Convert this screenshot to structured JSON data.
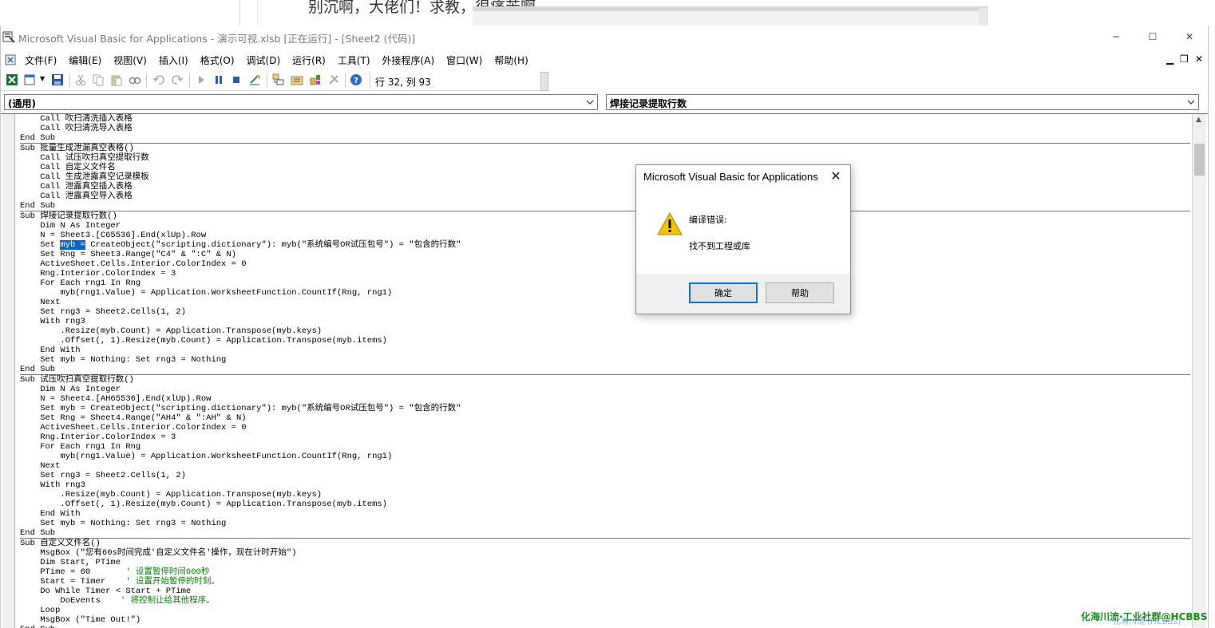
{
  "forum": {
    "text": "别沉啊，大佬们！求教，很痛苦啊 。。。"
  },
  "window": {
    "title": "Microsoft Visual Basic for Applications - 演示可视.xlsb [正在运行] - [Sheet2 (代码)]",
    "minimize": "─",
    "maximize": "☐",
    "close": "✕"
  },
  "menu": {
    "items": [
      "文件(F)",
      "编辑(E)",
      "视图(V)",
      "插入(I)",
      "格式(O)",
      "调试(D)",
      "运行(R)",
      "工具(T)",
      "外接程序(A)",
      "窗口(W)",
      "帮助(H)"
    ],
    "mdi_min": "▁",
    "mdi_restore": "❐",
    "mdi_close": "✕"
  },
  "toolbar": {
    "status": "行 32, 列 93",
    "icons": [
      "excel-icon",
      "insert-module-icon",
      "save-icon",
      "cut-icon",
      "copy-icon",
      "paste-icon",
      "find-icon",
      "undo-icon",
      "redo-icon",
      "run-icon",
      "break-icon",
      "reset-icon",
      "design-mode-icon",
      "project-explorer-icon",
      "properties-icon",
      "object-browser-icon",
      "toolbox-icon",
      "help-icon"
    ]
  },
  "combos": {
    "object": "(通用)",
    "procedure": "焊接记录提取行数"
  },
  "code": {
    "blocks": [
      [
        "    Call 吹扫清洗插入表格",
        "    Call 吹扫清洗导入表格",
        "End Sub"
      ],
      [
        "Sub 批量生成泄漏真空表格()",
        "    Call 试压吹扫真空提取行数",
        "    Call 自定义文件名",
        "    Call 生成泄露真空记录模板",
        "    Call 泄露真空插入表格",
        "    Call 泄露真空导入表格",
        "End Sub"
      ],
      [
        "Sub 焊接记录提取行数()",
        "    Dim N As Integer",
        "    N = Sheet3.[C65536].End(xlUp).Row",
        "    Set myb = CreateObject(\"scripting.dictionary\"): myb(\"系统编号OR试压包号\") = \"包含的行数\"",
        "    Set Rng = Sheet3.Range(\"C4\" & \":C\" & N)",
        "    ActiveSheet.Cells.Interior.ColorIndex = 0",
        "    Rng.Interior.ColorIndex = 3",
        "    For Each rng1 In Rng",
        "        myb(rng1.Value) = Application.WorksheetFunction.CountIf(Rng, rng1)",
        "    Next",
        "    Set rng3 = Sheet2.Cells(1, 2)",
        "    With rng3",
        "        .Resize(myb.Count) = Application.Transpose(myb.keys)",
        "        .Offset(, 1).Resize(myb.Count) = Application.Transpose(myb.items)",
        "    End With",
        "    Set myb = Nothing: Set rng3 = Nothing",
        "End Sub"
      ],
      [
        "Sub 试压吹扫真空提取行数()",
        "    Dim N As Integer",
        "    N = Sheet4.[AH65536].End(xlUp).Row",
        "    Set myb = CreateObject(\"scripting.dictionary\"): myb(\"系统编号OR试压包号\") = \"包含的行数\"",
        "    Set Rng = Sheet4.Range(\"AH4\" & \":AH\" & N)",
        "    ActiveSheet.Cells.Interior.ColorIndex = 0",
        "    Rng.Interior.ColorIndex = 3",
        "    For Each rng1 In Rng",
        "        myb(rng1.Value) = Application.WorksheetFunction.CountIf(Rng, rng1)",
        "    Next",
        "    Set rng3 = Sheet2.Cells(1, 2)",
        "    With rng3",
        "        .Resize(myb.Count) = Application.Transpose(myb.keys)",
        "        .Offset(, 1).Resize(myb.Count) = Application.Transpose(myb.items)",
        "    End With",
        "    Set myb = Nothing: Set rng3 = Nothing",
        "End Sub"
      ],
      [
        "Sub 自定义文件名()",
        "    MsgBox (\"您有60s时间完成'自定义文件名'操作，现在计时开始\")",
        "    Dim Start, PTime",
        "    PTime = 60       ",
        "    Start = Timer    ",
        "    Do While Timer < Start + PTime",
        "        DoEvents    ",
        "    Loop",
        "    MsgBox (\"Time Out!\")",
        "End Sub"
      ]
    ],
    "comments": {
      "ptime": "' 设置暂停时间600秒",
      "start": "' 设置开始暂停的时刻。",
      "doevents": "' 将控制让给其他程序。"
    },
    "selected_word": "myb ="
  },
  "dialog": {
    "title": "Microsoft Visual Basic for Applications",
    "close": "✕",
    "line1": "编译错误:",
    "line2": "找不到工程或库",
    "ok": "确定",
    "help": "帮助"
  },
  "watermark": {
    "text": "化海川流·工业社群@HCBBS",
    "sub": "化海川流 (HCBBS)"
  },
  "colors": {
    "selection": "#0a64c8",
    "comment": "#007f00",
    "warning": "#f5c400"
  }
}
